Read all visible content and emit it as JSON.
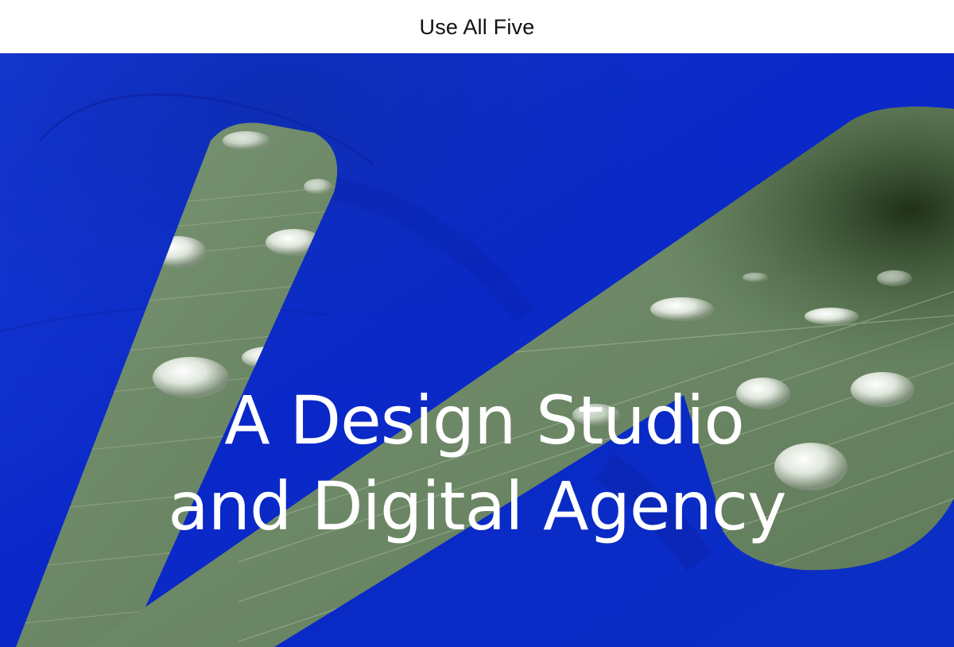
{
  "header": {
    "brand": "Use All Five"
  },
  "hero": {
    "headline_line1": "A Design Studio",
    "headline_line2": "and Digital Agency",
    "background_image": "blue-flower-petal-with-green-leaf-raindrops",
    "logo_shape": "two-slanted-pill-bars-icon"
  },
  "colors": {
    "header_bg": "#ffffff",
    "brand_text": "#111111",
    "petal_blue": "#0a2fd0",
    "leaf_green": "#6f8a68",
    "headline_text": "#ffffff"
  }
}
